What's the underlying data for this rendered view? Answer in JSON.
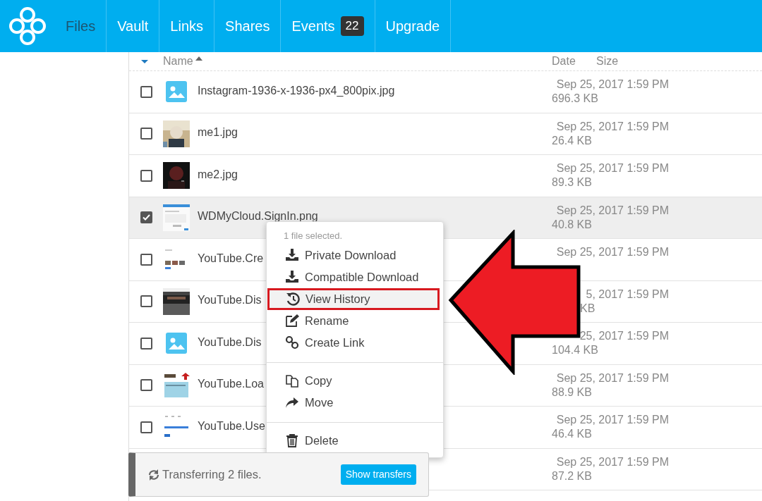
{
  "navbar": {
    "items": [
      {
        "label": "Files",
        "selected": true
      },
      {
        "label": "Vault",
        "selected": false
      },
      {
        "label": "Links",
        "selected": false
      },
      {
        "label": "Shares",
        "selected": false
      },
      {
        "label": "Events",
        "selected": false,
        "badge": "22"
      },
      {
        "label": "Upgrade",
        "selected": false
      }
    ]
  },
  "table": {
    "columns": [
      "Name",
      "Date",
      "Size"
    ],
    "rows": [
      {
        "thumbnail": {
          "kind": "icon"
        },
        "name": "Instagram-1936-x-1936-px4_800pix.jpg",
        "date": "Sep 25, 2017 1:59 PM",
        "size": "696.3 KB",
        "checked": false,
        "selected": false
      },
      {
        "name": "me1.jpg",
        "date": "Sep 25, 2017 1:59 PM",
        "size": "26.4 KB",
        "checked": false,
        "selected": false
      },
      {
        "name": "me2.jpg",
        "date": "Sep 25, 2017 1:59 PM",
        "size": "89.3 KB",
        "checked": false,
        "selected": false
      },
      {
        "name": "WDMyCloud.SignIn.png",
        "date": "Sep 25, 2017 1:59 PM",
        "size": "40.8 KB",
        "checked": true,
        "selected": true
      },
      {
        "name": "YouTube.Cre",
        "date": "Sep 25, 2017 1:59 PM",
        "checked": false,
        "selected": false
      },
      {
        "name": "YouTube.Dis",
        "date": "5, 2017 1:59 PM",
        "size": "KB",
        "covered": true,
        "checked": false,
        "selected": false
      },
      {
        "thumbnail": {
          "kind": "icon"
        },
        "name": "YouTube.Dis",
        "date": "25, 2017 1:59 PM",
        "size": "104.4 KB",
        "checked": false,
        "selected": false
      },
      {
        "name": "YouTube.Loa",
        "date": "Sep 25, 2017 1:59 PM",
        "size": "88.9 KB",
        "checked": false,
        "selected": false
      },
      {
        "name": "YouTube.Use",
        "date": "Sep 25, 2017 1:59 PM",
        "size": "46.4 KB",
        "checked": false,
        "selected": false
      },
      {
        "date": "Sep 25, 2017 1:59 PM",
        "size": "87.2 KB"
      }
    ]
  },
  "context_menu": {
    "caption": "1 file selected.",
    "groups": [
      [
        {
          "kind": "download",
          "label": "Private Download",
          "highlighted": false
        },
        {
          "kind": "download",
          "label": "Compatible Download",
          "highlighted": false
        },
        {
          "kind": "history",
          "label": "View History",
          "highlighted": true
        },
        {
          "kind": "rename",
          "label": "Rename",
          "highlighted": false
        },
        {
          "kind": "link",
          "label": "Create Link",
          "highlighted": false
        }
      ],
      [
        {
          "kind": "copy",
          "label": "Copy",
          "highlighted": false
        },
        {
          "kind": "move",
          "label": "Move",
          "highlighted": false
        }
      ],
      [
        {
          "kind": "delete",
          "label": "Delete",
          "highlighted": false
        }
      ]
    ]
  },
  "transfers": {
    "message": "Transferring 2 files.",
    "button": "Show transfers"
  }
}
